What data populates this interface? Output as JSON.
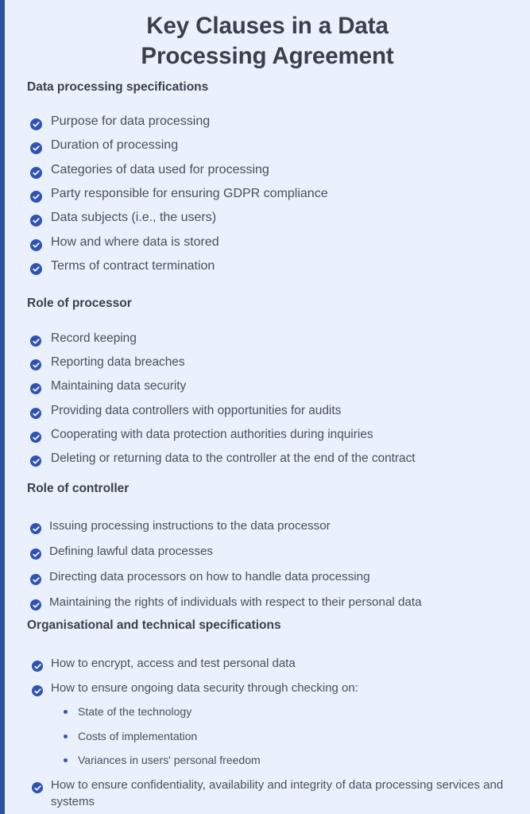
{
  "colors": {
    "background": "#eaf1fd",
    "left_rail": "#31529f",
    "bullet_blue": "#2f53b5",
    "heading_text": "#3b4048",
    "body_text": "#4a4f57"
  },
  "title": "Key Clauses in a Data Processing Agreement",
  "title_line_1": "Key Clauses in a Data",
  "title_line_2": "Processing Agreement",
  "icons": {
    "check": "check-circle-icon",
    "dot": "bullet-dot-icon"
  },
  "sections": [
    {
      "heading": "Data processing specifications",
      "items": [
        {
          "text": "Purpose for data processing"
        },
        {
          "text": "Duration of processing"
        },
        {
          "text": "Categories of data used for processing"
        },
        {
          "text": "Party responsible for ensuring GDPR compliance"
        },
        {
          "text": "Data subjects (i.e., the users)"
        },
        {
          "text": "How and where data is stored"
        },
        {
          "text": "Terms of contract termination"
        }
      ]
    },
    {
      "heading": "Role of processor",
      "items": [
        {
          "text": "Record keeping"
        },
        {
          "text": "Reporting data breaches"
        },
        {
          "text": "Maintaining data security"
        },
        {
          "text": "Providing data controllers with opportunities for audits"
        },
        {
          "text": "Cooperating with data protection authorities during inquiries"
        },
        {
          "text": "Deleting or returning data to the controller at the end of the contract"
        }
      ]
    },
    {
      "heading": "Role of controller",
      "items": [
        {
          "text": "Issuing processing instructions to the data processor"
        },
        {
          "text": "Defining lawful data processes"
        },
        {
          "text": "Directing data processors on how to handle data processing"
        },
        {
          "text": "Maintaining the rights of individuals with respect to their personal data"
        }
      ]
    },
    {
      "heading": "Organisational and technical specifications",
      "items": [
        {
          "text": "How to encrypt, access and test personal data"
        },
        {
          "text": "How to ensure ongoing data security through checking on:"
        },
        {
          "text": "State of the technology",
          "sub": true
        },
        {
          "text": "Costs of implementation",
          "sub": true
        },
        {
          "text": "Variances in users' personal freedom",
          "sub": true
        },
        {
          "text": "How to ensure confidentiality, availability and integrity of data processing services and systems"
        }
      ]
    }
  ]
}
